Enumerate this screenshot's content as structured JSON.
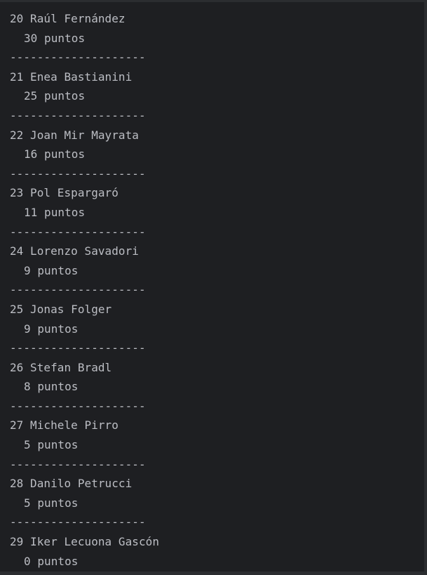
{
  "console": {
    "entries": [
      {
        "rider": "20 Raúl Fernández",
        "points": "30 puntos",
        "separator": "--------------------"
      },
      {
        "rider": "21 Enea Bastianini",
        "points": "25 puntos",
        "separator": "--------------------"
      },
      {
        "rider": "22 Joan Mir Mayrata",
        "points": "16 puntos",
        "separator": "--------------------"
      },
      {
        "rider": "23 Pol Espargaró",
        "points": "11 puntos",
        "separator": "--------------------"
      },
      {
        "rider": "24 Lorenzo Savadori",
        "points": "9 puntos",
        "separator": "--------------------"
      },
      {
        "rider": "25 Jonas Folger",
        "points": "9 puntos",
        "separator": "--------------------"
      },
      {
        "rider": "26 Stefan Bradl",
        "points": "8 puntos",
        "separator": "--------------------"
      },
      {
        "rider": "27 Michele Pirro",
        "points": "5 puntos",
        "separator": "--------------------"
      },
      {
        "rider": "28 Danilo Petrucci",
        "points": "5 puntos",
        "separator": "--------------------"
      },
      {
        "rider": "29 Iker Lecuona Gascón",
        "points": "0 puntos"
      }
    ]
  },
  "colors": {
    "background": "#1e1f22",
    "text": "#bcbec4",
    "frame": "#2b2d30"
  }
}
